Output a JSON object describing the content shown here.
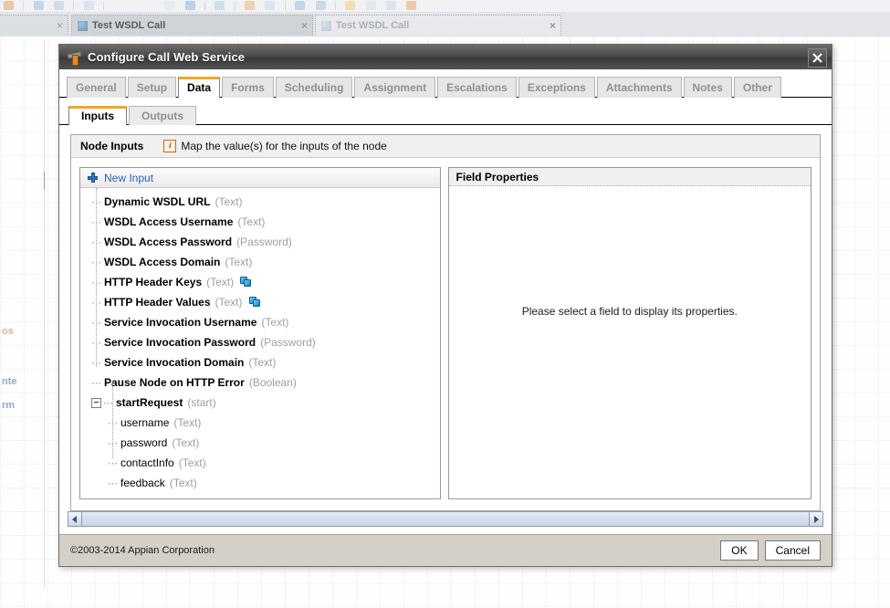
{
  "browser": {
    "tabs": [
      {
        "label": "",
        "active": false,
        "close_label": "×"
      },
      {
        "label": "Test WSDL Call",
        "active": true,
        "close_label": "×"
      },
      {
        "label": "Test WSDL Call",
        "active": false,
        "close_label": "×"
      }
    ],
    "left_fragments": [
      "os",
      "nte",
      "rm"
    ]
  },
  "dialog": {
    "title": "Configure Call Web Service",
    "title_icon": "hammer-icon",
    "close_label": "✕",
    "tabs": [
      {
        "label": "General",
        "active": false
      },
      {
        "label": "Setup",
        "active": false
      },
      {
        "label": "Data",
        "active": true
      },
      {
        "label": "Forms",
        "active": false
      },
      {
        "label": "Scheduling",
        "active": false
      },
      {
        "label": "Assignment",
        "active": false
      },
      {
        "label": "Escalations",
        "active": false
      },
      {
        "label": "Exceptions",
        "active": false
      },
      {
        "label": "Attachments",
        "active": false
      },
      {
        "label": "Notes",
        "active": false
      },
      {
        "label": "Other",
        "active": false
      }
    ],
    "subtabs": [
      {
        "label": "Inputs",
        "active": true
      },
      {
        "label": "Outputs",
        "active": false
      }
    ],
    "group": {
      "title": "Node Inputs",
      "info_icon": "info-icon",
      "hint": "Map the value(s) for the inputs of the node"
    },
    "left_pane": {
      "new_input_label": "New Input",
      "new_input_icon": "plus-icon",
      "nodes": [
        {
          "name": "Dynamic WSDL URL",
          "type": "(Text)",
          "child": false,
          "array": false,
          "expander": false
        },
        {
          "name": "WSDL Access Username",
          "type": "(Text)",
          "child": false,
          "array": false,
          "expander": false
        },
        {
          "name": "WSDL Access Password",
          "type": "(Password)",
          "child": false,
          "array": false,
          "expander": false
        },
        {
          "name": "WSDL Access Domain",
          "type": "(Text)",
          "child": false,
          "array": false,
          "expander": false
        },
        {
          "name": "HTTP Header Keys",
          "type": "(Text)",
          "child": false,
          "array": true,
          "expander": false
        },
        {
          "name": "HTTP Header Values",
          "type": "(Text)",
          "child": false,
          "array": true,
          "expander": false
        },
        {
          "name": "Service Invocation Username",
          "type": "(Text)",
          "child": false,
          "array": false,
          "expander": false
        },
        {
          "name": "Service Invocation Password",
          "type": "(Password)",
          "child": false,
          "array": false,
          "expander": false
        },
        {
          "name": "Service Invocation Domain",
          "type": "(Text)",
          "child": false,
          "array": false,
          "expander": false
        },
        {
          "name": "Pause Node on HTTP Error",
          "type": "(Boolean)",
          "child": false,
          "array": false,
          "expander": false
        },
        {
          "name": "startRequest",
          "type": "(start)",
          "child": false,
          "array": false,
          "expander": true
        },
        {
          "name": "username",
          "type": "(Text)",
          "child": true,
          "array": false,
          "expander": false
        },
        {
          "name": "password",
          "type": "(Text)",
          "child": true,
          "array": false,
          "expander": false
        },
        {
          "name": "contactInfo",
          "type": "(Text)",
          "child": true,
          "array": false,
          "expander": false
        },
        {
          "name": "feedback",
          "type": "(Text)",
          "child": true,
          "array": false,
          "expander": false
        }
      ]
    },
    "right_pane": {
      "title": "Field Properties",
      "empty_message": "Please select a field to display its properties."
    },
    "footer": {
      "copyright": "©2003-2014 Appian Corporation",
      "ok_label": "OK",
      "cancel_label": "Cancel"
    }
  },
  "colors": {
    "accent": "#f5a623",
    "link": "#2a62b8",
    "titlebar": "#4a4a4a",
    "dialog_chrome": "#d4d0c8"
  }
}
